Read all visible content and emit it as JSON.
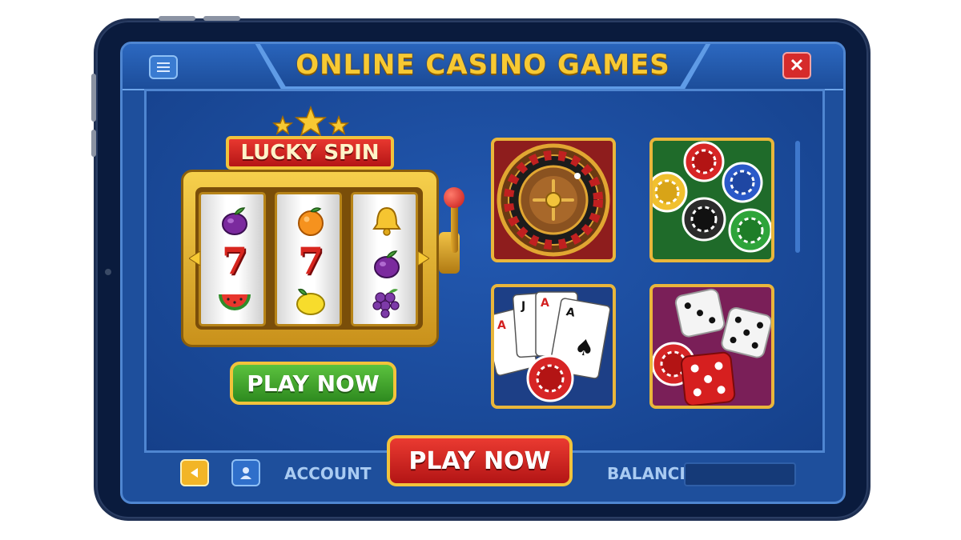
{
  "header": {
    "title": "ONLINE CASINO GAMES",
    "menu_icon": "hamburger-menu-icon",
    "close_icon": "close-icon",
    "close_glyph": "✕"
  },
  "slot_machine": {
    "sign": "LUCKY SPIN",
    "reels": [
      [
        "plum",
        "seven",
        "watermelon"
      ],
      [
        "orange",
        "seven",
        "lemon"
      ],
      [
        "bell",
        "plum",
        "grapes"
      ]
    ],
    "seven_glyph": "7",
    "play_button": "PLAY NOW"
  },
  "game_tiles": [
    {
      "name": "roulette",
      "icon": "roulette-wheel-icon",
      "bg": "#8e1d1d"
    },
    {
      "name": "poker-chips",
      "icon": "casino-chips-icon",
      "bg": "#1f6b2a"
    },
    {
      "name": "cards",
      "icon": "playing-cards-icon",
      "bg": "#1d3f86"
    },
    {
      "name": "dice",
      "icon": "dice-icon",
      "bg": "#7a1f58"
    }
  ],
  "footer": {
    "back_icon": "back-arrow-icon",
    "account_icon": "user-icon",
    "account_label": "ACCOUNT",
    "play_button": "PLAY NOW",
    "balance_label": "BALANCE",
    "balance_value": ""
  },
  "colors": {
    "gold": "#f7c933",
    "screen_blue": "#1e4f9c",
    "play_green": "#3aa62b",
    "play_red": "#d62b2b"
  }
}
